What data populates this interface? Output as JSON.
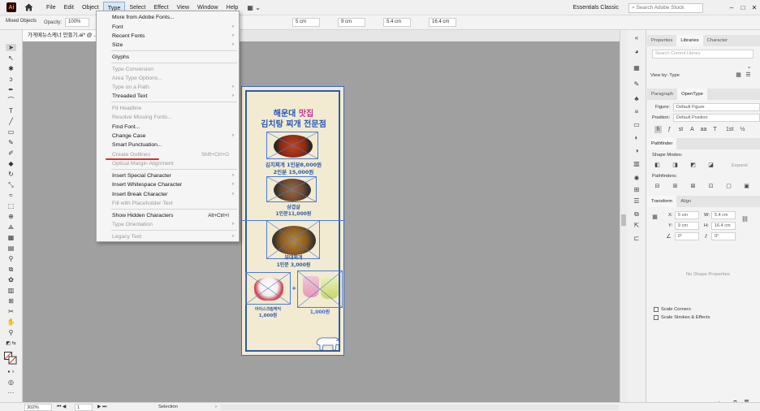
{
  "menubar": {
    "app_logo": "Ai",
    "items": [
      "File",
      "Edit",
      "Object",
      "Type",
      "Select",
      "Effect",
      "View",
      "Window",
      "Help"
    ],
    "active_item": "Type",
    "workspace": "Essentials Classic",
    "search_placeholder": "Search Adobe Stock"
  },
  "controlbar": {
    "mixed_objects": "Mixed Objects",
    "opacity_label": "Opacity:",
    "opacity_value": "100%",
    "x_value": "5 cm",
    "y_value": "9 cm",
    "w_value": "5.4 cm",
    "h_value": "16.4 cm"
  },
  "document_tab": {
    "title": "가게메뉴스케너 만들기.ai* @ ..."
  },
  "type_menu": {
    "items": [
      {
        "label": "More from Adobe Fonts...",
        "enabled": true,
        "submenu": false,
        "shortcut": ""
      },
      {
        "label": "Font",
        "enabled": true,
        "submenu": true,
        "shortcut": ""
      },
      {
        "label": "Recent Fonts",
        "enabled": true,
        "submenu": true,
        "shortcut": ""
      },
      {
        "label": "Size",
        "enabled": true,
        "submenu": true,
        "shortcut": ""
      },
      {
        "label": "Glyphs",
        "enabled": true,
        "submenu": false,
        "shortcut": ""
      },
      {
        "label": "Type Conversion",
        "enabled": false,
        "submenu": false,
        "shortcut": ""
      },
      {
        "label": "Area Type Options...",
        "enabled": false,
        "submenu": false,
        "shortcut": ""
      },
      {
        "label": "Type on a Path",
        "enabled": false,
        "submenu": true,
        "shortcut": ""
      },
      {
        "label": "Threaded Text",
        "enabled": true,
        "submenu": true,
        "shortcut": ""
      },
      {
        "label": "Fit Headline",
        "enabled": false,
        "submenu": false,
        "shortcut": ""
      },
      {
        "label": "Resolve Missing Fonts...",
        "enabled": false,
        "submenu": false,
        "shortcut": ""
      },
      {
        "label": "Find Font...",
        "enabled": true,
        "submenu": false,
        "shortcut": ""
      },
      {
        "label": "Change Case",
        "enabled": true,
        "submenu": true,
        "shortcut": ""
      },
      {
        "label": "Smart Punctuation...",
        "enabled": true,
        "submenu": false,
        "shortcut": ""
      },
      {
        "label": "Create Outlines",
        "enabled": false,
        "submenu": false,
        "shortcut": "Shift+Ctrl+O"
      },
      {
        "label": "Optical Margin Alignment",
        "enabled": false,
        "submenu": false,
        "shortcut": ""
      },
      {
        "label": "Insert Special Character",
        "enabled": true,
        "submenu": true,
        "shortcut": ""
      },
      {
        "label": "Insert Whitespace Character",
        "enabled": true,
        "submenu": true,
        "shortcut": ""
      },
      {
        "label": "Insert Break Character",
        "enabled": true,
        "submenu": true,
        "shortcut": ""
      },
      {
        "label": "Fill with Placeholder Text",
        "enabled": false,
        "submenu": false,
        "shortcut": ""
      },
      {
        "label": "Show Hidden Characters",
        "enabled": true,
        "submenu": false,
        "shortcut": "Alt+Ctrl+I"
      },
      {
        "label": "Type Orientation",
        "enabled": false,
        "submenu": true,
        "shortcut": ""
      },
      {
        "label": "Legacy Text",
        "enabled": false,
        "submenu": true,
        "shortcut": ""
      }
    ]
  },
  "artboard": {
    "title_line1_a": "해운대 ",
    "title_line1_b": "맛집",
    "title_line2": "김치탕 찌개 전문점",
    "item1_line1": "김치찌개 1인분8,000원",
    "item1_line2": "2인분 15,000원",
    "item2_name": "삼겹살",
    "item2_price": "1인분11,000원",
    "item3_name": "부대찌개",
    "item3_price": "1인분 3,000원",
    "item4_name": "아이스크림케익",
    "item4_price": "1,000원",
    "item5_price": "1,000원",
    "plus": "+"
  },
  "panels": {
    "top_tabs": [
      "Properties",
      "Libraries",
      "Character"
    ],
    "search_placeholder": "Search Current Library",
    "view_by": "View by: Type",
    "para_tabs": [
      "Paragraph",
      "OpenType"
    ],
    "figure_label": "Figure:",
    "figure_value": "Default Figure",
    "position_label": "Position:",
    "position_value": "Default Position",
    "ot_glyphs": [
      "fi",
      "ƒ",
      "st",
      "A",
      "aa",
      "T",
      "1st",
      "½"
    ],
    "pathfinder_tab": "Pathfinder",
    "shape_modes": "Shape Modes:",
    "expand": "Expand",
    "pathfinders": "Pathfinders:",
    "transform_tabs": [
      "Transform",
      "Align"
    ],
    "x_label": "X:",
    "x_value": "5 cm",
    "y_label": "Y:",
    "y_value": "9 cm",
    "w_label": "W:",
    "w_value": "5.4 cm",
    "h_label": "H:",
    "h_value": "16.4 cm",
    "angle_value": "0°",
    "shear_value": "0°",
    "no_shape": "No Shape Properties",
    "scale_corners": "Scale Corners",
    "scale_strokes": "Scale Strokes & Effects"
  },
  "statusbar": {
    "zoom": "302%",
    "artboard_num": "1",
    "tool": "Selection"
  },
  "colors": {
    "accent_blue": "#2f5aa7",
    "selection_blue": "#4a7bd8",
    "menu_highlight": "#d9e6f5",
    "underline_red": "#e0302a",
    "artboard_bg": "#f2ebd2",
    "canvas_bg": "#a0a0a0"
  }
}
